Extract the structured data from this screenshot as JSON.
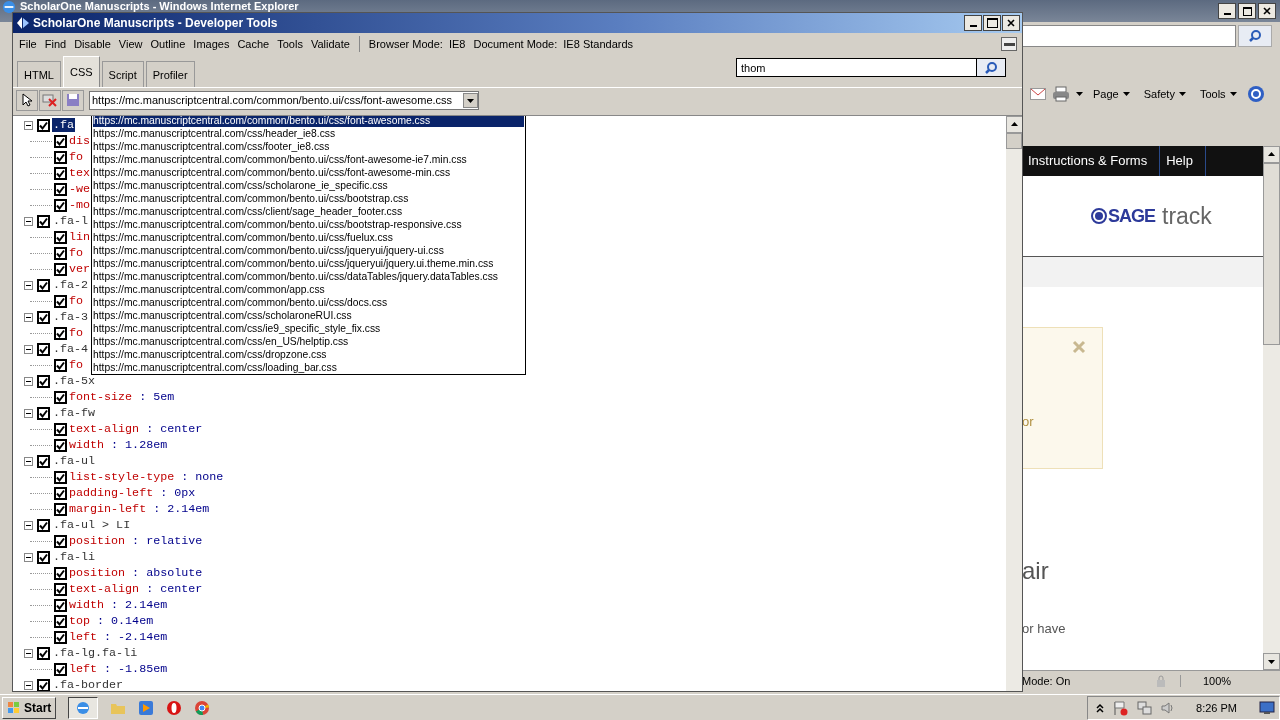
{
  "browser": {
    "title": "ScholarOne Manuscripts - Windows Internet Explorer",
    "command_bar": [
      "Page",
      "Safety",
      "Tools"
    ],
    "nav": [
      {
        "label": "Instructions & Forms"
      },
      {
        "label": "Help"
      }
    ],
    "logo": {
      "brand": "SAGE",
      "product": "track"
    },
    "alert_text": "or",
    "heading": "air",
    "body_text": "or have",
    "status": {
      "mode": "Mode: On",
      "zoom": "100%"
    }
  },
  "devtools": {
    "title": "ScholarOne Manuscripts - Developer Tools",
    "menu": [
      "File",
      "Find",
      "Disable",
      "View",
      "Outline",
      "Images",
      "Cache",
      "Tools",
      "Validate"
    ],
    "browser_mode": "Browser Mode:  IE8",
    "document_mode": "Document Mode:  IE8 Standards",
    "tabs": [
      {
        "label": "HTML",
        "selected": false
      },
      {
        "label": "CSS",
        "selected": true
      },
      {
        "label": "Script",
        "selected": false
      },
      {
        "label": "Profiler",
        "selected": false
      }
    ],
    "search": {
      "value": "thom"
    },
    "stylesheet": {
      "value": "https://mc.manuscriptcentral.com/common/bento.ui/css/font-awesome.css",
      "options": [
        {
          "label": "https://mc.manuscriptcentral.com/common/bento.ui/css/font-awesome.css",
          "selected": true
        },
        {
          "label": "https://mc.manuscriptcentral.com/css/header_ie8.css",
          "selected": false
        },
        {
          "label": "https://mc.manuscriptcentral.com/css/footer_ie8.css",
          "selected": false
        },
        {
          "label": "https://mc.manuscriptcentral.com/common/bento.ui/css/font-awesome-ie7.min.css",
          "selected": false
        },
        {
          "label": "https://mc.manuscriptcentral.com/common/bento.ui/css/font-awesome-min.css",
          "selected": false
        },
        {
          "label": "https://mc.manuscriptcentral.com/css/scholarone_ie_specific.css",
          "selected": false
        },
        {
          "label": "https://mc.manuscriptcentral.com/common/bento.ui/css/bootstrap.css",
          "selected": false
        },
        {
          "label": "https://mc.manuscriptcentral.com/css/client/sage_header_footer.css",
          "selected": false
        },
        {
          "label": "https://mc.manuscriptcentral.com/common/bento.ui/css/bootstrap-responsive.css",
          "selected": false
        },
        {
          "label": "https://mc.manuscriptcentral.com/common/bento.ui/css/fuelux.css",
          "selected": false
        },
        {
          "label": "https://mc.manuscriptcentral.com/common/bento.ui/css/jqueryui/jquery-ui.css",
          "selected": false
        },
        {
          "label": "https://mc.manuscriptcentral.com/common/bento.ui/css/jqueryui/jquery.ui.theme.min.css",
          "selected": false
        },
        {
          "label": "https://mc.manuscriptcentral.com/common/bento.ui/css/dataTables/jquery.dataTables.css",
          "selected": false
        },
        {
          "label": "https://mc.manuscriptcentral.com/common/app.css",
          "selected": false
        },
        {
          "label": "https://mc.manuscriptcentral.com/common/bento.ui/css/docs.css",
          "selected": false
        },
        {
          "label": "https://mc.manuscriptcentral.com/css/scholaroneRUI.css",
          "selected": false
        },
        {
          "label": "https://mc.manuscriptcentral.com/css/ie9_specific_style_fix.css",
          "selected": false
        },
        {
          "label": "https://mc.manuscriptcentral.com/css/en_US/helptip.css",
          "selected": false
        },
        {
          "label": "https://mc.manuscriptcentral.com/css/dropzone.css",
          "selected": false
        },
        {
          "label": "https://mc.manuscriptcentral.com/css/loading_bar.css",
          "selected": false
        }
      ]
    },
    "rules": [
      {
        "selector": ".fa",
        "selected": true,
        "checked": true,
        "expanded": true,
        "props": [
          {
            "name": "dis",
            "checked": true
          },
          {
            "name": "fo",
            "checked": true
          },
          {
            "name": "tex",
            "checked": true
          },
          {
            "name": "-we",
            "checked": true
          },
          {
            "name": "-mo",
            "checked": true
          }
        ]
      },
      {
        "selector": ".fa-l",
        "selected": false,
        "checked": true,
        "expanded": true,
        "props": [
          {
            "name": "lin",
            "checked": true
          },
          {
            "name": "fo",
            "checked": true
          },
          {
            "name": "ver",
            "checked": true
          }
        ]
      },
      {
        "selector": ".fa-2",
        "selected": false,
        "checked": true,
        "expanded": true,
        "props": [
          {
            "name": "fo",
            "checked": true
          }
        ]
      },
      {
        "selector": ".fa-3",
        "selected": false,
        "checked": true,
        "expanded": true,
        "props": [
          {
            "name": "fo",
            "checked": true
          }
        ]
      },
      {
        "selector": ".fa-4",
        "selected": false,
        "checked": true,
        "expanded": true,
        "props": [
          {
            "name": "fo",
            "checked": true
          }
        ]
      },
      {
        "selector": ".fa-5x",
        "selected": false,
        "checked": true,
        "expanded": true,
        "props": [
          {
            "name": "font-size",
            "value": ": 5em",
            "checked": true
          }
        ]
      },
      {
        "selector": ".fa-fw",
        "selected": false,
        "checked": true,
        "expanded": true,
        "props": [
          {
            "name": "text-align",
            "value": ": center",
            "checked": true
          },
          {
            "name": "width",
            "value": ": 1.28em",
            "checked": true
          }
        ]
      },
      {
        "selector": ".fa-ul",
        "selected": false,
        "checked": true,
        "expanded": true,
        "props": [
          {
            "name": "list-style-type",
            "value": ": none",
            "checked": true
          },
          {
            "name": "padding-left",
            "value": ": 0px",
            "checked": true
          },
          {
            "name": "margin-left",
            "value": ": 2.14em",
            "checked": true
          }
        ]
      },
      {
        "selector": ".fa-ul > LI",
        "selected": false,
        "checked": true,
        "expanded": true,
        "props": [
          {
            "name": "position",
            "value": ": relative",
            "checked": true
          }
        ]
      },
      {
        "selector": ".fa-li",
        "selected": false,
        "checked": true,
        "expanded": true,
        "props": [
          {
            "name": "position",
            "value": ": absolute",
            "checked": true
          },
          {
            "name": "text-align",
            "value": ": center",
            "checked": true
          },
          {
            "name": "width",
            "value": ": 2.14em",
            "checked": true
          },
          {
            "name": "top",
            "value": ": 0.14em",
            "checked": true
          },
          {
            "name": "left",
            "value": ": -2.14em",
            "checked": true
          }
        ]
      },
      {
        "selector": ".fa-lg.fa-li",
        "selected": false,
        "checked": true,
        "expanded": true,
        "props": [
          {
            "name": "left",
            "value": ": -1.85em",
            "checked": true
          }
        ]
      },
      {
        "selector": ".fa-border",
        "selected": false,
        "checked": true,
        "expanded": true
      }
    ]
  },
  "taskbar": {
    "start": "Start",
    "clock": "8:26 PM"
  }
}
